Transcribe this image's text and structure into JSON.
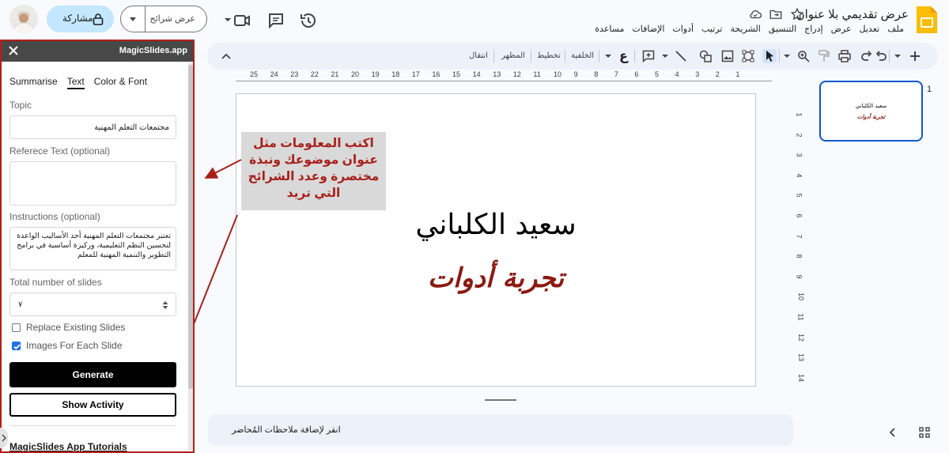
{
  "app": {
    "doc_title": "عرض تقديمي بلا عنوان",
    "menu": [
      "ملف",
      "تعديل",
      "عرض",
      "إدراج",
      "التنسيق",
      "الشريحة",
      "ترتيب",
      "أدوات",
      "الإضافات",
      "مساعدة"
    ],
    "slideshow_label": "عرض شرائح",
    "share_label": "مشاركة"
  },
  "toolbar": {
    "transition": "انتقال",
    "theme": "المظهر",
    "layout": "تخطيط",
    "background": "الخلفية",
    "text_glyph": "ع"
  },
  "ruler": {
    "horizontal": [
      "25",
      "24",
      "23",
      "22",
      "21",
      "20",
      "19",
      "18",
      "17",
      "16",
      "15",
      "14",
      "13",
      "12",
      "11",
      "10",
      "9",
      "8",
      "7",
      "6",
      "5",
      "4",
      "3",
      "2",
      "1"
    ],
    "vertical": [
      "1",
      "2",
      "3",
      "4",
      "5",
      "6",
      "7",
      "8",
      "9",
      "10",
      "11",
      "12",
      "13",
      "14"
    ]
  },
  "slide": {
    "title": "سعيد الكلباني",
    "subtitle": "تجربة أدوات",
    "notes_placeholder": "انقر لإضافة ملاحظات المُحاضر"
  },
  "annotation": {
    "text": "اكتب المعلومات مثل عنوان موضوعك ونبذة مختصرة وعدد الشرائح التي تريد"
  },
  "filmstrip": {
    "number": "1",
    "thumb_title": "سعيد الكلباني",
    "thumb_sub": "تجربة أدوات"
  },
  "panel": {
    "title": "MagicSlides.app",
    "tabs": [
      "Summarise",
      "Text",
      "Color & Font"
    ],
    "topic_label": "Topic",
    "topic_value": "مجتمعات التعلم المهنية",
    "reference_label": "Referece Text (optional)",
    "reference_value": "",
    "instructions_label": "Instructions (optional)",
    "instructions_value": "تعتبر مجتمعات التعلم المهنية أحد الأساليب الواعدة لتحسين النظم التعليمية، وركيزة أساسية في برامج التطوير والتنمية المهنية للمعلم",
    "slides_label": "Total number of slides",
    "slides_value": "٧",
    "replace_label": "Replace Existing Slides",
    "replace_checked": false,
    "images_label": "Images For Each Slide",
    "images_checked": true,
    "generate_label": "Generate",
    "activity_label": "Show Activity",
    "tutorials_label": "MagicSlides App Tutorials"
  },
  "colors": {
    "accent_red": "#b32018",
    "share_blue": "#c2e7ff",
    "selection_blue": "#0b57d0",
    "subtitle_red": "#8b1a10"
  }
}
